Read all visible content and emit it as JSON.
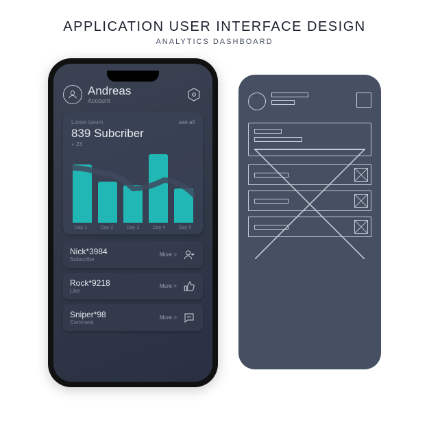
{
  "page": {
    "title": "APPLICATION USER INTERFACE DESIGN",
    "subtitle": "ANALYTICS DASHBOARD"
  },
  "user": {
    "name": "Andreas",
    "label": "Account"
  },
  "card": {
    "lorem": "Lorem ipsum",
    "see_all": "see all",
    "count_text": "839 Subcriber",
    "delta": "+ 23"
  },
  "chart_data": {
    "type": "bar",
    "categories": [
      "Day 1",
      "Day 2",
      "Day 3",
      "Day 4",
      "Day 5"
    ],
    "values": [
      85,
      60,
      55,
      100,
      50
    ],
    "overlay_line": [
      80,
      72,
      50,
      62,
      40
    ],
    "title": "",
    "xlabel": "",
    "ylabel": "",
    "ylim": [
      0,
      100
    ]
  },
  "events": [
    {
      "name": "Nick*3984",
      "action": "Subscribe",
      "more": "More >",
      "icon": "add-user-icon"
    },
    {
      "name": "Rock*9218",
      "action": "Like",
      "more": "More >",
      "icon": "thumbs-up-icon"
    },
    {
      "name": "Sniper*98",
      "action": "Comment",
      "more": "More >",
      "icon": "comment-icon"
    }
  ],
  "colors": {
    "screen_bg": "#343c4e",
    "accent": "#20b7b4",
    "wireframe_bg": "#475062",
    "line": "#c5cbd6"
  }
}
